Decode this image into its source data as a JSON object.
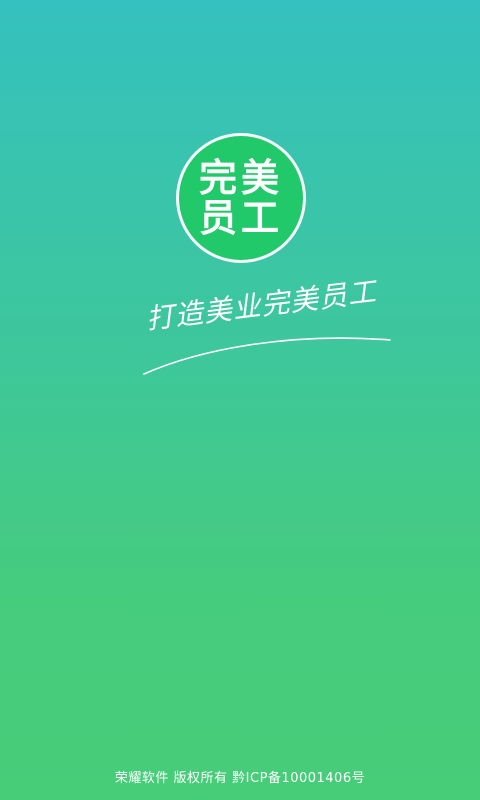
{
  "logo": {
    "line1": "完美",
    "line2": "员工"
  },
  "slogan": "打造美业完美员工",
  "footer": {
    "text": "荣耀软件  版权所有  黔ICP备10001406号"
  },
  "colors": {
    "gradient_top": "#35c1bf",
    "gradient_bottom": "#47cd78",
    "logo_circle": "#21c96a",
    "text": "#ffffff"
  }
}
